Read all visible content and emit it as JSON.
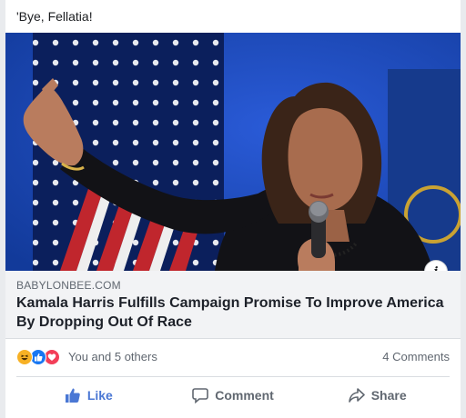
{
  "post": {
    "text": "'Bye, Fellatia!"
  },
  "link": {
    "domain": "BABYLONBEE.COM",
    "title": "Kamala Harris Fulfills Campaign Promise To Improve America By Dropping Out Of Race",
    "info_label": "i"
  },
  "reactions": {
    "icons": [
      "haha-icon",
      "like-icon",
      "love-icon"
    ],
    "summary": "You and 5 others",
    "comments": "4 Comments"
  },
  "actions": {
    "like": "Like",
    "comment": "Comment",
    "share": "Share"
  },
  "colors": {
    "like_blue": "#4a77d4",
    "haha": "#f7b125",
    "love": "#f33e58",
    "secondary_text": "#606770"
  }
}
